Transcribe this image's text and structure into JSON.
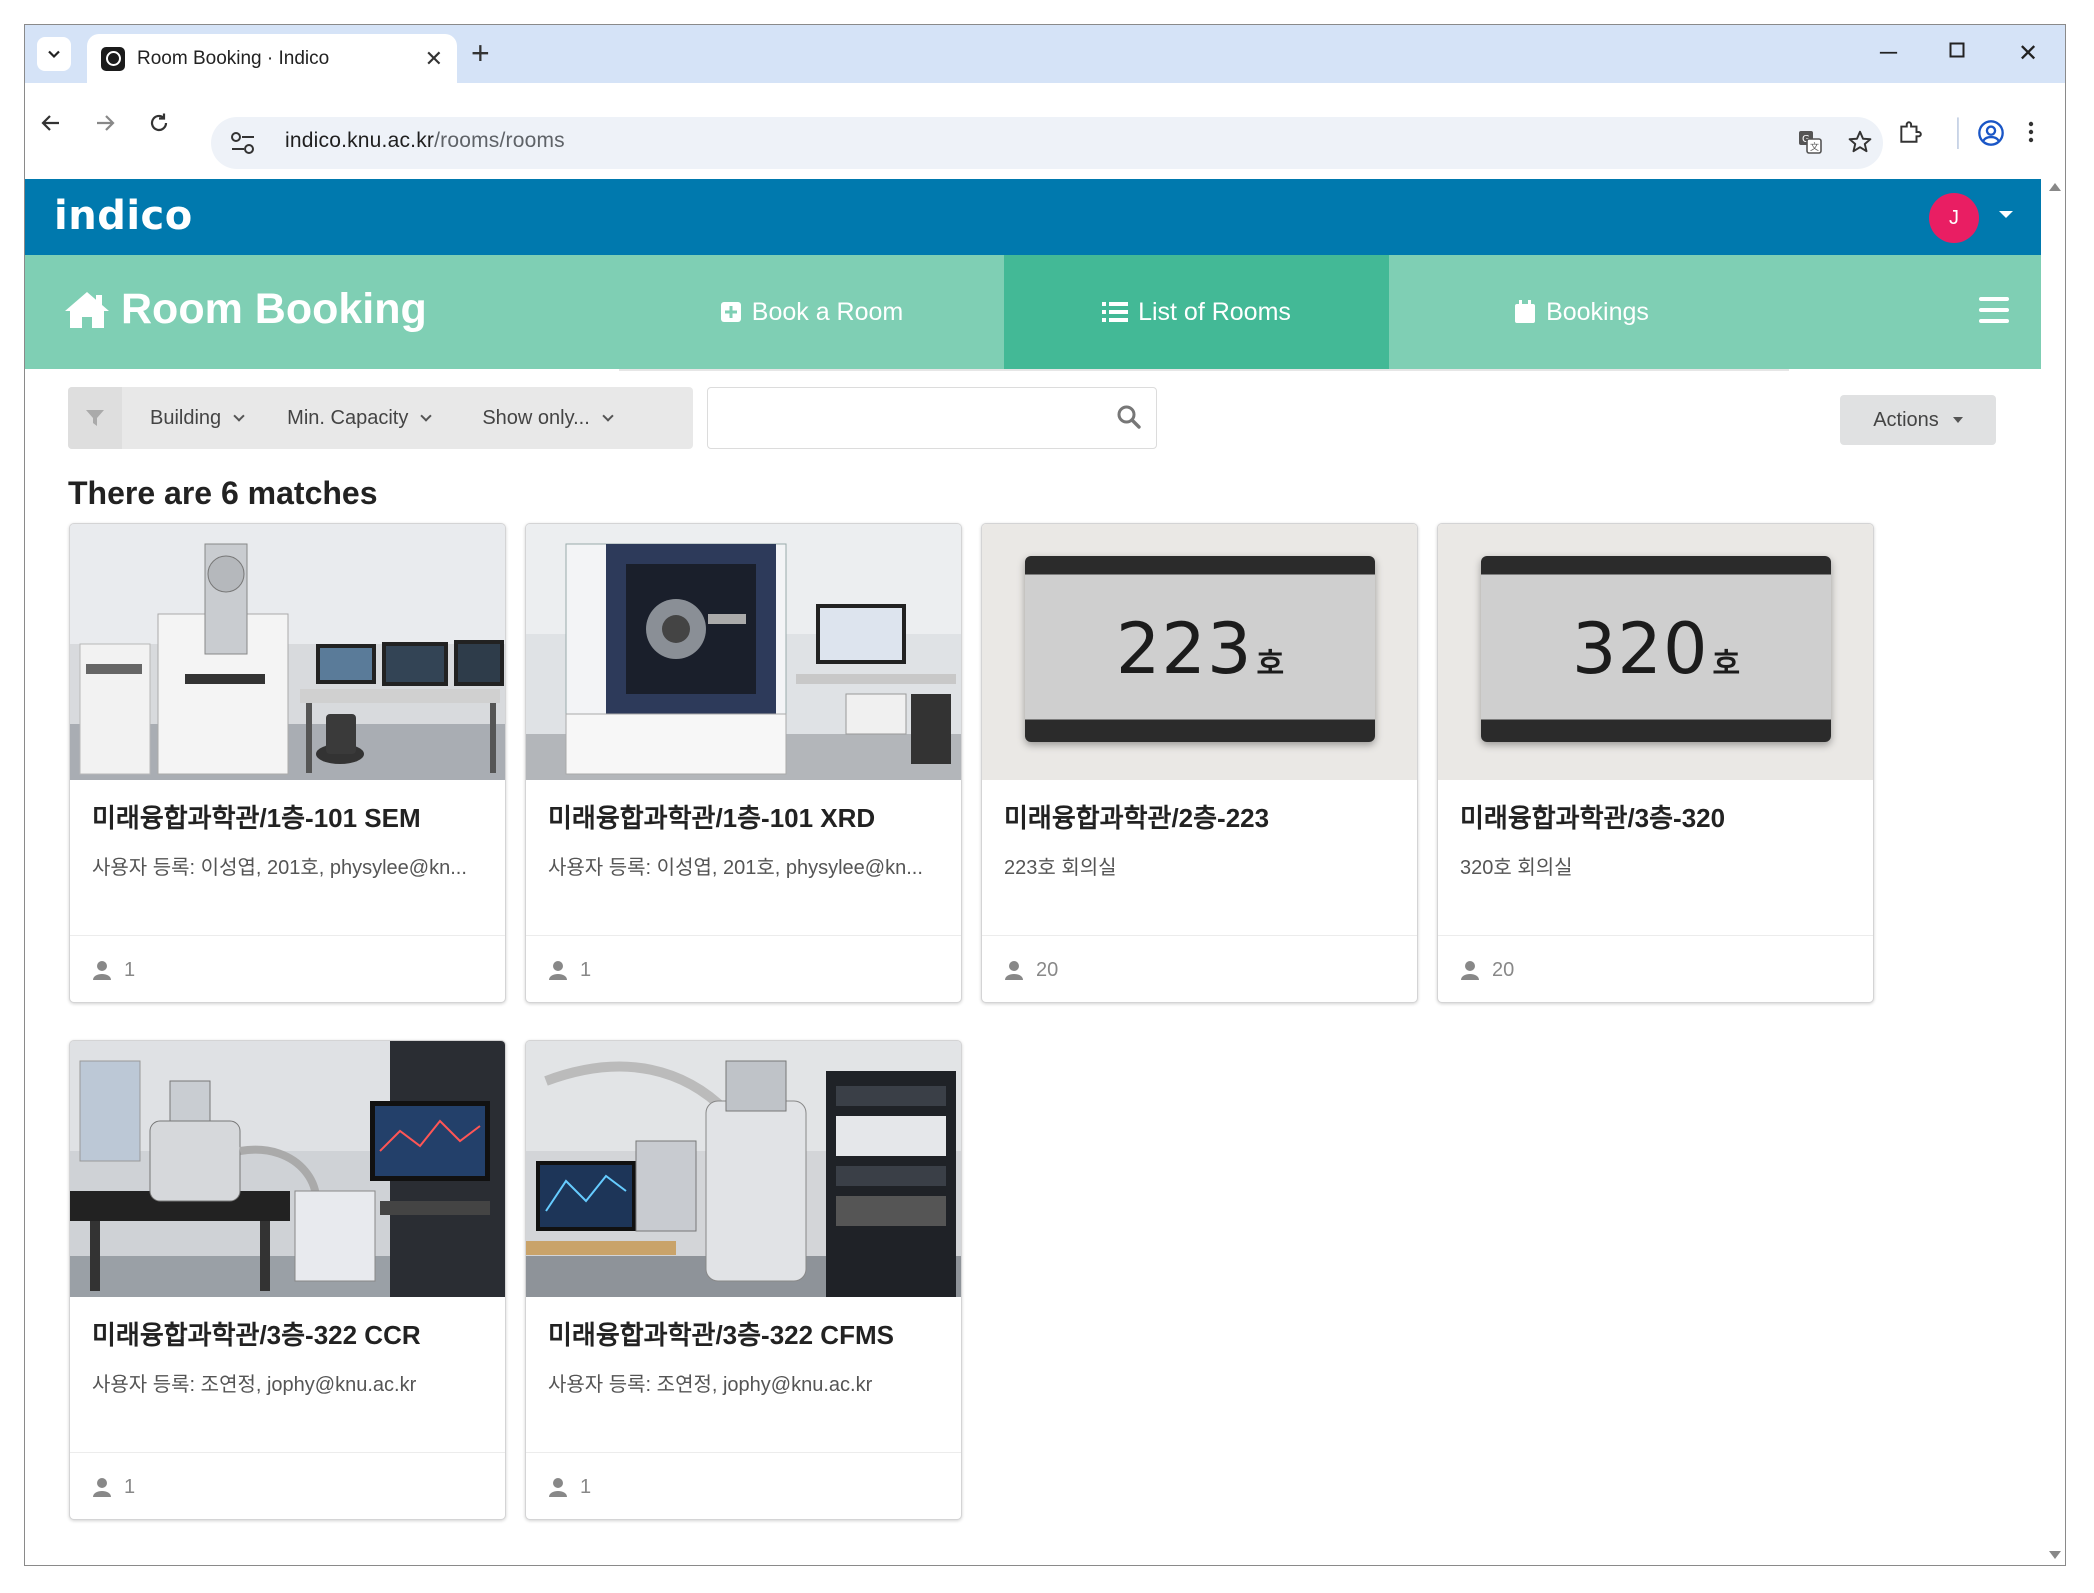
{
  "browser": {
    "tab_title": "Room Booking · Indico",
    "url_host": "indico.knu.ac.kr",
    "url_path": "/rooms/rooms"
  },
  "header": {
    "logo": "indico",
    "avatar_initial": "J"
  },
  "room_booking": {
    "title": "Room Booking",
    "menu": [
      {
        "label": "Book a Room",
        "icon": "plus-square-icon"
      },
      {
        "label": "List of Rooms",
        "icon": "list-icon",
        "active": true
      },
      {
        "label": "Bookings",
        "icon": "calendar-icon"
      }
    ]
  },
  "filters": {
    "building": "Building",
    "min_capacity": "Min. Capacity",
    "show_only": "Show only...",
    "search_placeholder": "",
    "actions": "Actions"
  },
  "matches_text": "There are 6 matches",
  "rooms": [
    {
      "name": "미래융합과학관/1층-101 SEM",
      "description": "사용자 등록: 이성엽, 201호, physylee@kn...",
      "capacity": "1"
    },
    {
      "name": "미래융합과학관/1층-101 XRD",
      "description": "사용자 등록: 이성엽, 201호, physylee@kn...",
      "capacity": "1"
    },
    {
      "name": "미래융합과학관/2층-223",
      "description": "223호 회의실",
      "capacity": "20",
      "plate_number": "223",
      "plate_suffix": "호"
    },
    {
      "name": "미래융합과학관/3층-320",
      "description": "320호 회의실",
      "capacity": "20",
      "plate_number": "320",
      "plate_suffix": "호"
    },
    {
      "name": "미래융합과학관/3층-322 CCR",
      "description": "사용자 등록: 조연정, jophy@knu.ac.kr",
      "capacity": "1"
    },
    {
      "name": "미래융합과학관/3층-322 CFMS",
      "description": "사용자 등록: 조연정, jophy@knu.ac.kr",
      "capacity": "1"
    }
  ],
  "colors": {
    "topbar": "#0079ae",
    "rb_bar": "#7fcfb4",
    "rb_active": "#43b996",
    "avatar": "#e91e63"
  }
}
